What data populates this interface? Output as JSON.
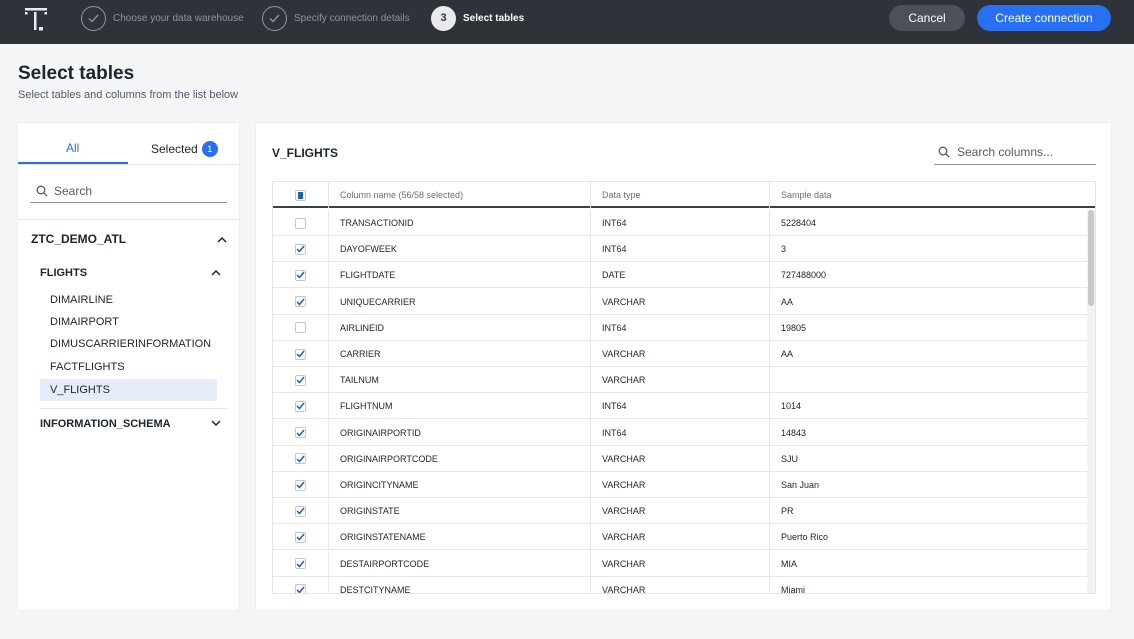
{
  "header": {
    "steps": [
      {
        "number": "",
        "label": "Choose your data warehouse",
        "state": "done"
      },
      {
        "number": "",
        "label": "Specify connection details",
        "state": "done"
      },
      {
        "number": "3",
        "label": "Select tables",
        "state": "active"
      }
    ],
    "cancel_label": "Cancel",
    "create_label": "Create connection"
  },
  "page": {
    "title": "Select tables",
    "subtitle": "Select tables and columns from the list below"
  },
  "sidebar": {
    "tab_all": "All",
    "tab_selected": "Selected",
    "selected_count": "1",
    "search_placeholder": "Search",
    "database": "ZTC_DEMO_ATL",
    "schema": "FLIGHTS",
    "tables": [
      "DIMAIRLINE",
      "DIMAIRPORT",
      "DIMUSCARRIERINFORMATION",
      "FACTFLIGHTS",
      "V_FLIGHTS"
    ],
    "selected_table": "V_FLIGHTS",
    "schema2": "INFORMATION_SCHEMA"
  },
  "main": {
    "table_title": "V_FLIGHTS",
    "search_placeholder": "Search columns...",
    "headers": {
      "column_name": "Column name (56/58 selected)",
      "data_type": "Data type",
      "sample_data": "Sample data"
    },
    "rows": [
      {
        "checked": false,
        "name": "TRANSACTIONID",
        "type": "INT64",
        "sample": "5228404"
      },
      {
        "checked": true,
        "name": "DAYOFWEEK",
        "type": "INT64",
        "sample": "3"
      },
      {
        "checked": true,
        "name": "FLIGHTDATE",
        "type": "DATE",
        "sample": "727488000"
      },
      {
        "checked": true,
        "name": "UNIQUECARRIER",
        "type": "VARCHAR",
        "sample": "AA"
      },
      {
        "checked": false,
        "name": "AIRLINEID",
        "type": "INT64",
        "sample": "19805"
      },
      {
        "checked": true,
        "name": "CARRIER",
        "type": "VARCHAR",
        "sample": "AA"
      },
      {
        "checked": true,
        "name": "TAILNUM",
        "type": "VARCHAR",
        "sample": ""
      },
      {
        "checked": true,
        "name": "FLIGHTNUM",
        "type": "INT64",
        "sample": "1014"
      },
      {
        "checked": true,
        "name": "ORIGINAIRPORTID",
        "type": "INT64",
        "sample": "14843"
      },
      {
        "checked": true,
        "name": "ORIGINAIRPORTCODE",
        "type": "VARCHAR",
        "sample": "SJU"
      },
      {
        "checked": true,
        "name": "ORIGINCITYNAME",
        "type": "VARCHAR",
        "sample": "San Juan"
      },
      {
        "checked": true,
        "name": "ORIGINSTATE",
        "type": "VARCHAR",
        "sample": "PR"
      },
      {
        "checked": true,
        "name": "ORIGINSTATENAME",
        "type": "VARCHAR",
        "sample": "Puerto Rico"
      },
      {
        "checked": true,
        "name": "DESTAIRPORTCODE",
        "type": "VARCHAR",
        "sample": "MIA"
      },
      {
        "checked": true,
        "name": "DESTCITYNAME",
        "type": "VARCHAR",
        "sample": "Miami"
      }
    ]
  },
  "colors": {
    "accent": "#2770ef",
    "topbar": "#2e3239",
    "checkmark": "#1f5fb8"
  }
}
